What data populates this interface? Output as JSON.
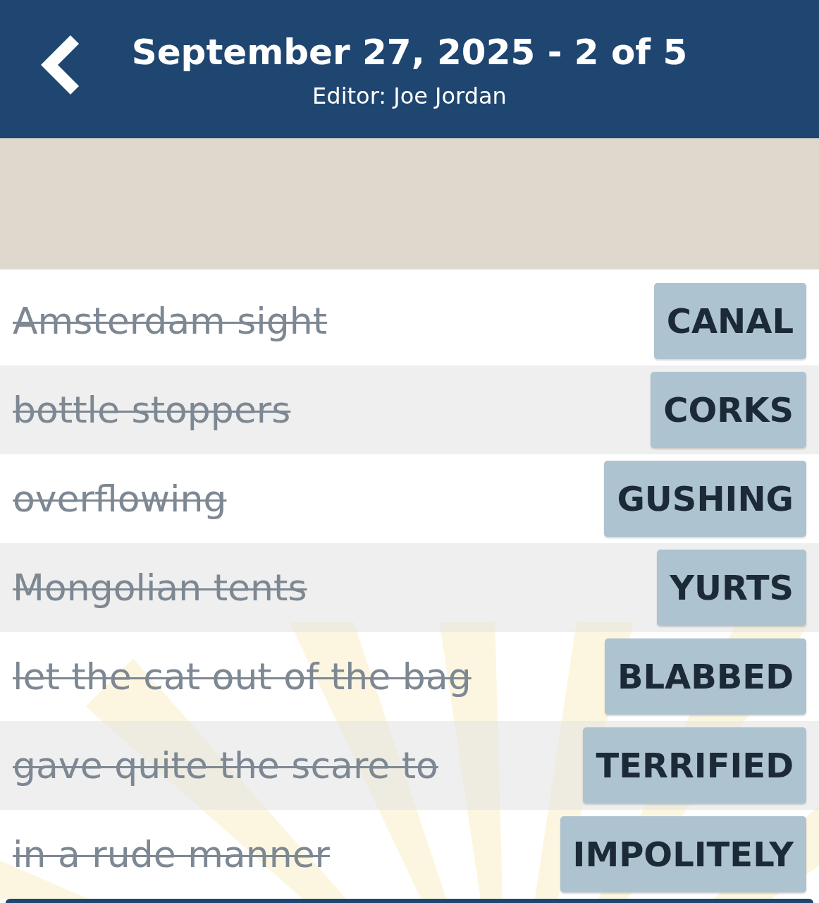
{
  "header": {
    "title": "September 27, 2025 - 2 of 5",
    "subtitle": "Editor: Joe Jordan"
  },
  "clues": [
    {
      "clue": "Amsterdam sight",
      "answer": "CANAL",
      "solved": true
    },
    {
      "clue": "bottle stoppers",
      "answer": "CORKS",
      "solved": true
    },
    {
      "clue": "overflowing",
      "answer": "GUSHING",
      "solved": true
    },
    {
      "clue": "Mongolian tents",
      "answer": "YURTS",
      "solved": true
    },
    {
      "clue": "let the cat out of the bag",
      "answer": "BLABBED",
      "solved": true
    },
    {
      "clue": "gave quite the scare to",
      "answer": "TERRIFIED",
      "solved": true
    },
    {
      "clue": "in a rude manner",
      "answer": "IMPOLITELY",
      "solved": true
    }
  ]
}
